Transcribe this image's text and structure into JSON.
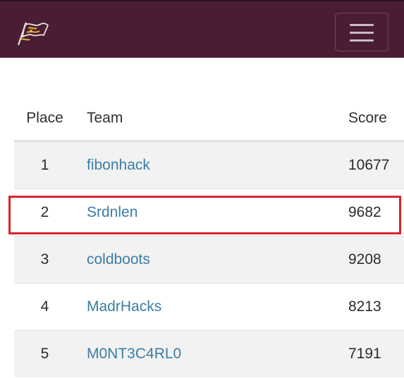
{
  "navbar": {
    "logo_icon": "flag-logo-icon",
    "menu_icon": "hamburger-menu-icon",
    "colors": {
      "background": "#4a1d35"
    }
  },
  "scoreboard": {
    "headers": {
      "place": "Place",
      "team": "Team",
      "score": "Score"
    },
    "rows": [
      {
        "place": "1",
        "team": "fibonhack",
        "score": "10677"
      },
      {
        "place": "2",
        "team": "Srdnlen",
        "score": "9682"
      },
      {
        "place": "3",
        "team": "coldboots",
        "score": "9208"
      },
      {
        "place": "4",
        "team": "MadrHacks",
        "score": "8213"
      },
      {
        "place": "5",
        "team": "M0NT3C4RL0",
        "score": "7191"
      }
    ],
    "highlighted_team": "Srdnlen",
    "colors": {
      "link": "#3b7da3",
      "highlight": "#d8242c",
      "stripe": "#f2f2f2"
    }
  }
}
